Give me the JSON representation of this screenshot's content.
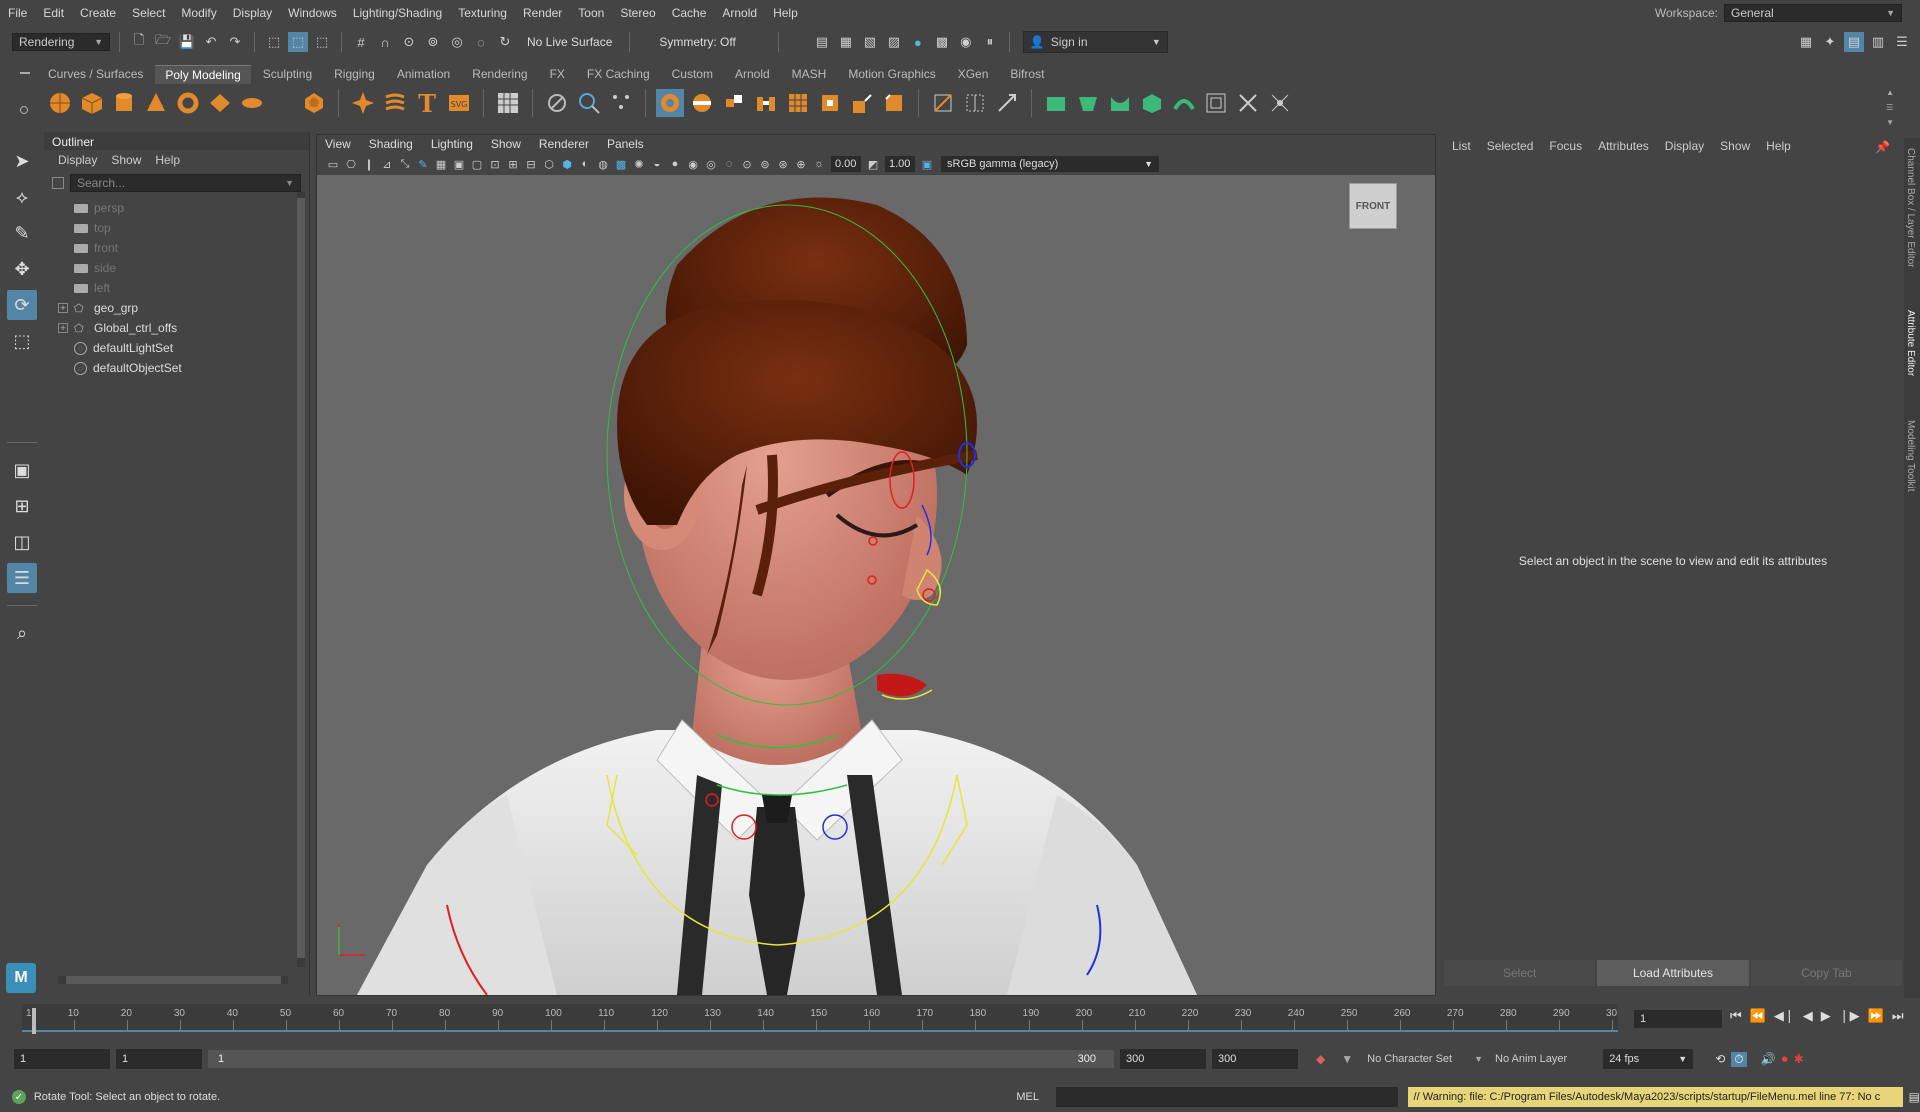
{
  "menubar": {
    "items": [
      "File",
      "Edit",
      "Create",
      "Select",
      "Modify",
      "Display",
      "Windows",
      "Lighting/Shading",
      "Texturing",
      "Render",
      "Toon",
      "Stereo",
      "Cache",
      "Arnold",
      "Help"
    ],
    "workspace_label": "Workspace:",
    "workspace_value": "General"
  },
  "statusline": {
    "menuset": "Rendering",
    "live_surface": "No Live Surface",
    "symmetry": "Symmetry: Off",
    "sign_in": "Sign in"
  },
  "shelf": {
    "tabs": [
      "Curves / Surfaces",
      "Poly Modeling",
      "Sculpting",
      "Rigging",
      "Animation",
      "Rendering",
      "FX",
      "FX Caching",
      "Custom",
      "Arnold",
      "MASH",
      "Motion Graphics",
      "XGen",
      "Bifrost"
    ],
    "active_tab": "Poly Modeling"
  },
  "outliner": {
    "title": "Outliner",
    "menu": [
      "Display",
      "Show",
      "Help"
    ],
    "search_placeholder": "Search...",
    "items": [
      {
        "label": "persp",
        "type": "camera",
        "dim": true
      },
      {
        "label": "top",
        "type": "camera",
        "dim": true
      },
      {
        "label": "front",
        "type": "camera",
        "dim": true
      },
      {
        "label": "side",
        "type": "camera",
        "dim": true
      },
      {
        "label": "left",
        "type": "camera",
        "dim": true
      },
      {
        "label": "geo_grp",
        "type": "group",
        "expandable": true
      },
      {
        "label": "Global_ctrl_offs",
        "type": "group",
        "expandable": true
      },
      {
        "label": "defaultLightSet",
        "type": "set"
      },
      {
        "label": "defaultObjectSet",
        "type": "set"
      }
    ]
  },
  "viewport": {
    "menu": [
      "View",
      "Shading",
      "Lighting",
      "Show",
      "Renderer",
      "Panels"
    ],
    "exposure": "0.00",
    "gamma": "1.00",
    "colorspace": "sRGB gamma (legacy)",
    "view_cube": "FRONT"
  },
  "attribute_editor": {
    "menu": [
      "List",
      "Selected",
      "Focus",
      "Attributes",
      "Display",
      "Show",
      "Help"
    ],
    "empty_message": "Select an object in the scene to view and edit its attributes",
    "buttons": {
      "select": "Select",
      "load": "Load Attributes",
      "copy": "Copy Tab"
    },
    "side_tabs": [
      "Channel Box / Layer Editor",
      "Attribute Editor",
      "Modeling Toolkit"
    ]
  },
  "timeline": {
    "ticks": [
      "10",
      "20",
      "30",
      "40",
      "50",
      "60",
      "70",
      "80",
      "90",
      "100",
      "110",
      "120",
      "130",
      "140",
      "150",
      "160",
      "170",
      "180",
      "190",
      "200",
      "210",
      "220",
      "230",
      "240",
      "250",
      "260",
      "270",
      "280",
      "290",
      "30"
    ],
    "start_frame": "1",
    "current_frame": "1"
  },
  "range": {
    "start": "1",
    "playback_start": "1",
    "range_start_label": "1",
    "range_end_label": "300",
    "playback_end": "300",
    "end": "300",
    "character_set": "No Character Set",
    "anim_layer": "No Anim Layer",
    "fps": "24 fps"
  },
  "commandline": {
    "help": "Rotate Tool: Select an object to rotate.",
    "mel": "MEL",
    "warning": "// Warning: file: C:/Program Files/Autodesk/Maya2023/scripts/startup/FileMenu.mel line 77: No c"
  },
  "colors": {
    "accent": "#5285a6",
    "skin": "#d88c7a",
    "hair": "#6e2a10",
    "shirt": "#e8e8e8",
    "ctrl_yellow": "#e6e63a",
    "ctrl_red": "#e02020",
    "ctrl_blue": "#2030e0",
    "ctrl_green": "#30c040",
    "warning_bg": "#e8d57a"
  }
}
